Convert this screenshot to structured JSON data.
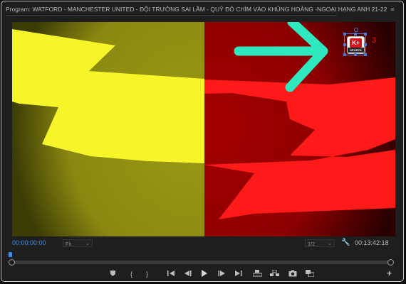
{
  "panel": {
    "title": "Program: WATFORD - MANCHESTER UNITED - ĐỘI TRƯỞNG SAI LẦM - QUỶ ĐỎ CHÌM VÀO KHỦNG HOẢNG -NGOẠI HẠNG ANH 21-22",
    "menu_glyph": "≡"
  },
  "viewer": {
    "colors": {
      "yellow": "#f5f52a",
      "red": "#ff1a1a",
      "left_bg": "#8c8b12",
      "right_bg": "#8f0000",
      "arrow": "#2ee8c0"
    },
    "logo": {
      "name": "K+ SPORTS",
      "kplus_text": "K+",
      "sports_text": "SPORTS",
      "index": "3"
    }
  },
  "controls": {
    "current_timecode": "00:00:00:00",
    "fit_label": "Fit",
    "resolution": "1/2",
    "duration_timecode": "00:13:42:18",
    "icons": [
      "add-marker-icon",
      "mark-in-icon",
      "mark-out-icon",
      "go-to-in-icon",
      "step-back-icon",
      "play-icon",
      "step-forward-icon",
      "go-to-out-icon",
      "lift-icon",
      "extract-icon",
      "export-frame-icon",
      "comparison-view-icon",
      "add-button-icon"
    ]
  }
}
